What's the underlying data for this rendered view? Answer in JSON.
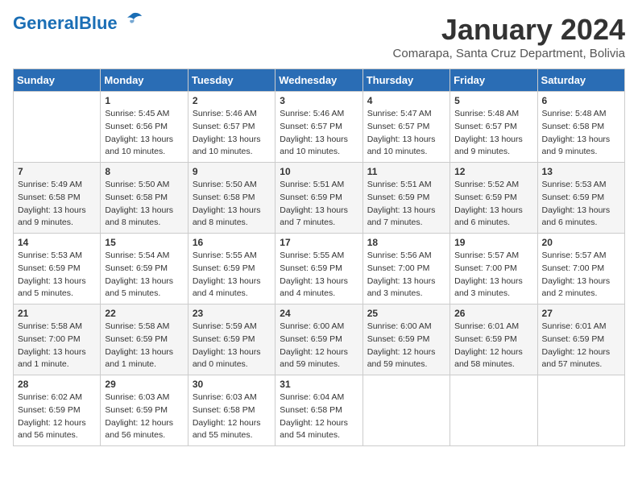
{
  "header": {
    "logo_general": "General",
    "logo_blue": "Blue",
    "month_title": "January 2024",
    "location": "Comarapa, Santa Cruz Department, Bolivia"
  },
  "days_of_week": [
    "Sunday",
    "Monday",
    "Tuesday",
    "Wednesday",
    "Thursday",
    "Friday",
    "Saturday"
  ],
  "weeks": [
    [
      {
        "day": "",
        "info": ""
      },
      {
        "day": "1",
        "info": "Sunrise: 5:45 AM\nSunset: 6:56 PM\nDaylight: 13 hours\nand 10 minutes."
      },
      {
        "day": "2",
        "info": "Sunrise: 5:46 AM\nSunset: 6:57 PM\nDaylight: 13 hours\nand 10 minutes."
      },
      {
        "day": "3",
        "info": "Sunrise: 5:46 AM\nSunset: 6:57 PM\nDaylight: 13 hours\nand 10 minutes."
      },
      {
        "day": "4",
        "info": "Sunrise: 5:47 AM\nSunset: 6:57 PM\nDaylight: 13 hours\nand 10 minutes."
      },
      {
        "day": "5",
        "info": "Sunrise: 5:48 AM\nSunset: 6:57 PM\nDaylight: 13 hours\nand 9 minutes."
      },
      {
        "day": "6",
        "info": "Sunrise: 5:48 AM\nSunset: 6:58 PM\nDaylight: 13 hours\nand 9 minutes."
      }
    ],
    [
      {
        "day": "7",
        "info": "Sunrise: 5:49 AM\nSunset: 6:58 PM\nDaylight: 13 hours\nand 9 minutes."
      },
      {
        "day": "8",
        "info": "Sunrise: 5:50 AM\nSunset: 6:58 PM\nDaylight: 13 hours\nand 8 minutes."
      },
      {
        "day": "9",
        "info": "Sunrise: 5:50 AM\nSunset: 6:58 PM\nDaylight: 13 hours\nand 8 minutes."
      },
      {
        "day": "10",
        "info": "Sunrise: 5:51 AM\nSunset: 6:59 PM\nDaylight: 13 hours\nand 7 minutes."
      },
      {
        "day": "11",
        "info": "Sunrise: 5:51 AM\nSunset: 6:59 PM\nDaylight: 13 hours\nand 7 minutes."
      },
      {
        "day": "12",
        "info": "Sunrise: 5:52 AM\nSunset: 6:59 PM\nDaylight: 13 hours\nand 6 minutes."
      },
      {
        "day": "13",
        "info": "Sunrise: 5:53 AM\nSunset: 6:59 PM\nDaylight: 13 hours\nand 6 minutes."
      }
    ],
    [
      {
        "day": "14",
        "info": "Sunrise: 5:53 AM\nSunset: 6:59 PM\nDaylight: 13 hours\nand 5 minutes."
      },
      {
        "day": "15",
        "info": "Sunrise: 5:54 AM\nSunset: 6:59 PM\nDaylight: 13 hours\nand 5 minutes."
      },
      {
        "day": "16",
        "info": "Sunrise: 5:55 AM\nSunset: 6:59 PM\nDaylight: 13 hours\nand 4 minutes."
      },
      {
        "day": "17",
        "info": "Sunrise: 5:55 AM\nSunset: 6:59 PM\nDaylight: 13 hours\nand 4 minutes."
      },
      {
        "day": "18",
        "info": "Sunrise: 5:56 AM\nSunset: 7:00 PM\nDaylight: 13 hours\nand 3 minutes."
      },
      {
        "day": "19",
        "info": "Sunrise: 5:57 AM\nSunset: 7:00 PM\nDaylight: 13 hours\nand 3 minutes."
      },
      {
        "day": "20",
        "info": "Sunrise: 5:57 AM\nSunset: 7:00 PM\nDaylight: 13 hours\nand 2 minutes."
      }
    ],
    [
      {
        "day": "21",
        "info": "Sunrise: 5:58 AM\nSunset: 7:00 PM\nDaylight: 13 hours\nand 1 minute."
      },
      {
        "day": "22",
        "info": "Sunrise: 5:58 AM\nSunset: 6:59 PM\nDaylight: 13 hours\nand 1 minute."
      },
      {
        "day": "23",
        "info": "Sunrise: 5:59 AM\nSunset: 6:59 PM\nDaylight: 13 hours\nand 0 minutes."
      },
      {
        "day": "24",
        "info": "Sunrise: 6:00 AM\nSunset: 6:59 PM\nDaylight: 12 hours\nand 59 minutes."
      },
      {
        "day": "25",
        "info": "Sunrise: 6:00 AM\nSunset: 6:59 PM\nDaylight: 12 hours\nand 59 minutes."
      },
      {
        "day": "26",
        "info": "Sunrise: 6:01 AM\nSunset: 6:59 PM\nDaylight: 12 hours\nand 58 minutes."
      },
      {
        "day": "27",
        "info": "Sunrise: 6:01 AM\nSunset: 6:59 PM\nDaylight: 12 hours\nand 57 minutes."
      }
    ],
    [
      {
        "day": "28",
        "info": "Sunrise: 6:02 AM\nSunset: 6:59 PM\nDaylight: 12 hours\nand 56 minutes."
      },
      {
        "day": "29",
        "info": "Sunrise: 6:03 AM\nSunset: 6:59 PM\nDaylight: 12 hours\nand 56 minutes."
      },
      {
        "day": "30",
        "info": "Sunrise: 6:03 AM\nSunset: 6:58 PM\nDaylight: 12 hours\nand 55 minutes."
      },
      {
        "day": "31",
        "info": "Sunrise: 6:04 AM\nSunset: 6:58 PM\nDaylight: 12 hours\nand 54 minutes."
      },
      {
        "day": "",
        "info": ""
      },
      {
        "day": "",
        "info": ""
      },
      {
        "day": "",
        "info": ""
      }
    ]
  ]
}
